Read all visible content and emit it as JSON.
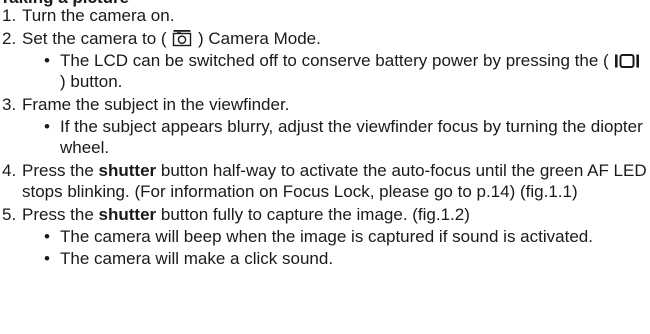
{
  "heading_fragment": "Taking a picture",
  "icons": {
    "camera_mode": "camera-mode-icon",
    "lcd_button": "lcd-display-button-icon"
  },
  "steps": [
    {
      "num": "1.",
      "text": "Turn the camera on."
    },
    {
      "num": "2.",
      "text_pre": "Set the camera to ( ",
      "text_post": " ) Camera Mode.",
      "subs": [
        {
          "pre": "The LCD can be switched off to conserve battery power by pressing the ( ",
          "post": " ) button."
        }
      ]
    },
    {
      "num": "3.",
      "text": "Frame the subject in the viewfinder.",
      "subs": [
        {
          "text": "If the subject appears blurry, adjust the viewfinder focus by turning the diopter wheel."
        }
      ]
    },
    {
      "num": "4.",
      "text_pre": "Press the ",
      "bold": "shutter",
      "text_post": " button half-way to activate the auto-focus until the green AF LED stops blinking. (For information on Focus Lock, please go to p.14) (fig.1.1)"
    },
    {
      "num": "5.",
      "text_pre": "Press the ",
      "bold": "shutter",
      "text_post": " button fully to capture the image. (fig.1.2)",
      "subs": [
        {
          "text": "The camera will beep when the image is captured if sound is activated."
        },
        {
          "text": "The camera will make a click sound."
        }
      ]
    }
  ]
}
